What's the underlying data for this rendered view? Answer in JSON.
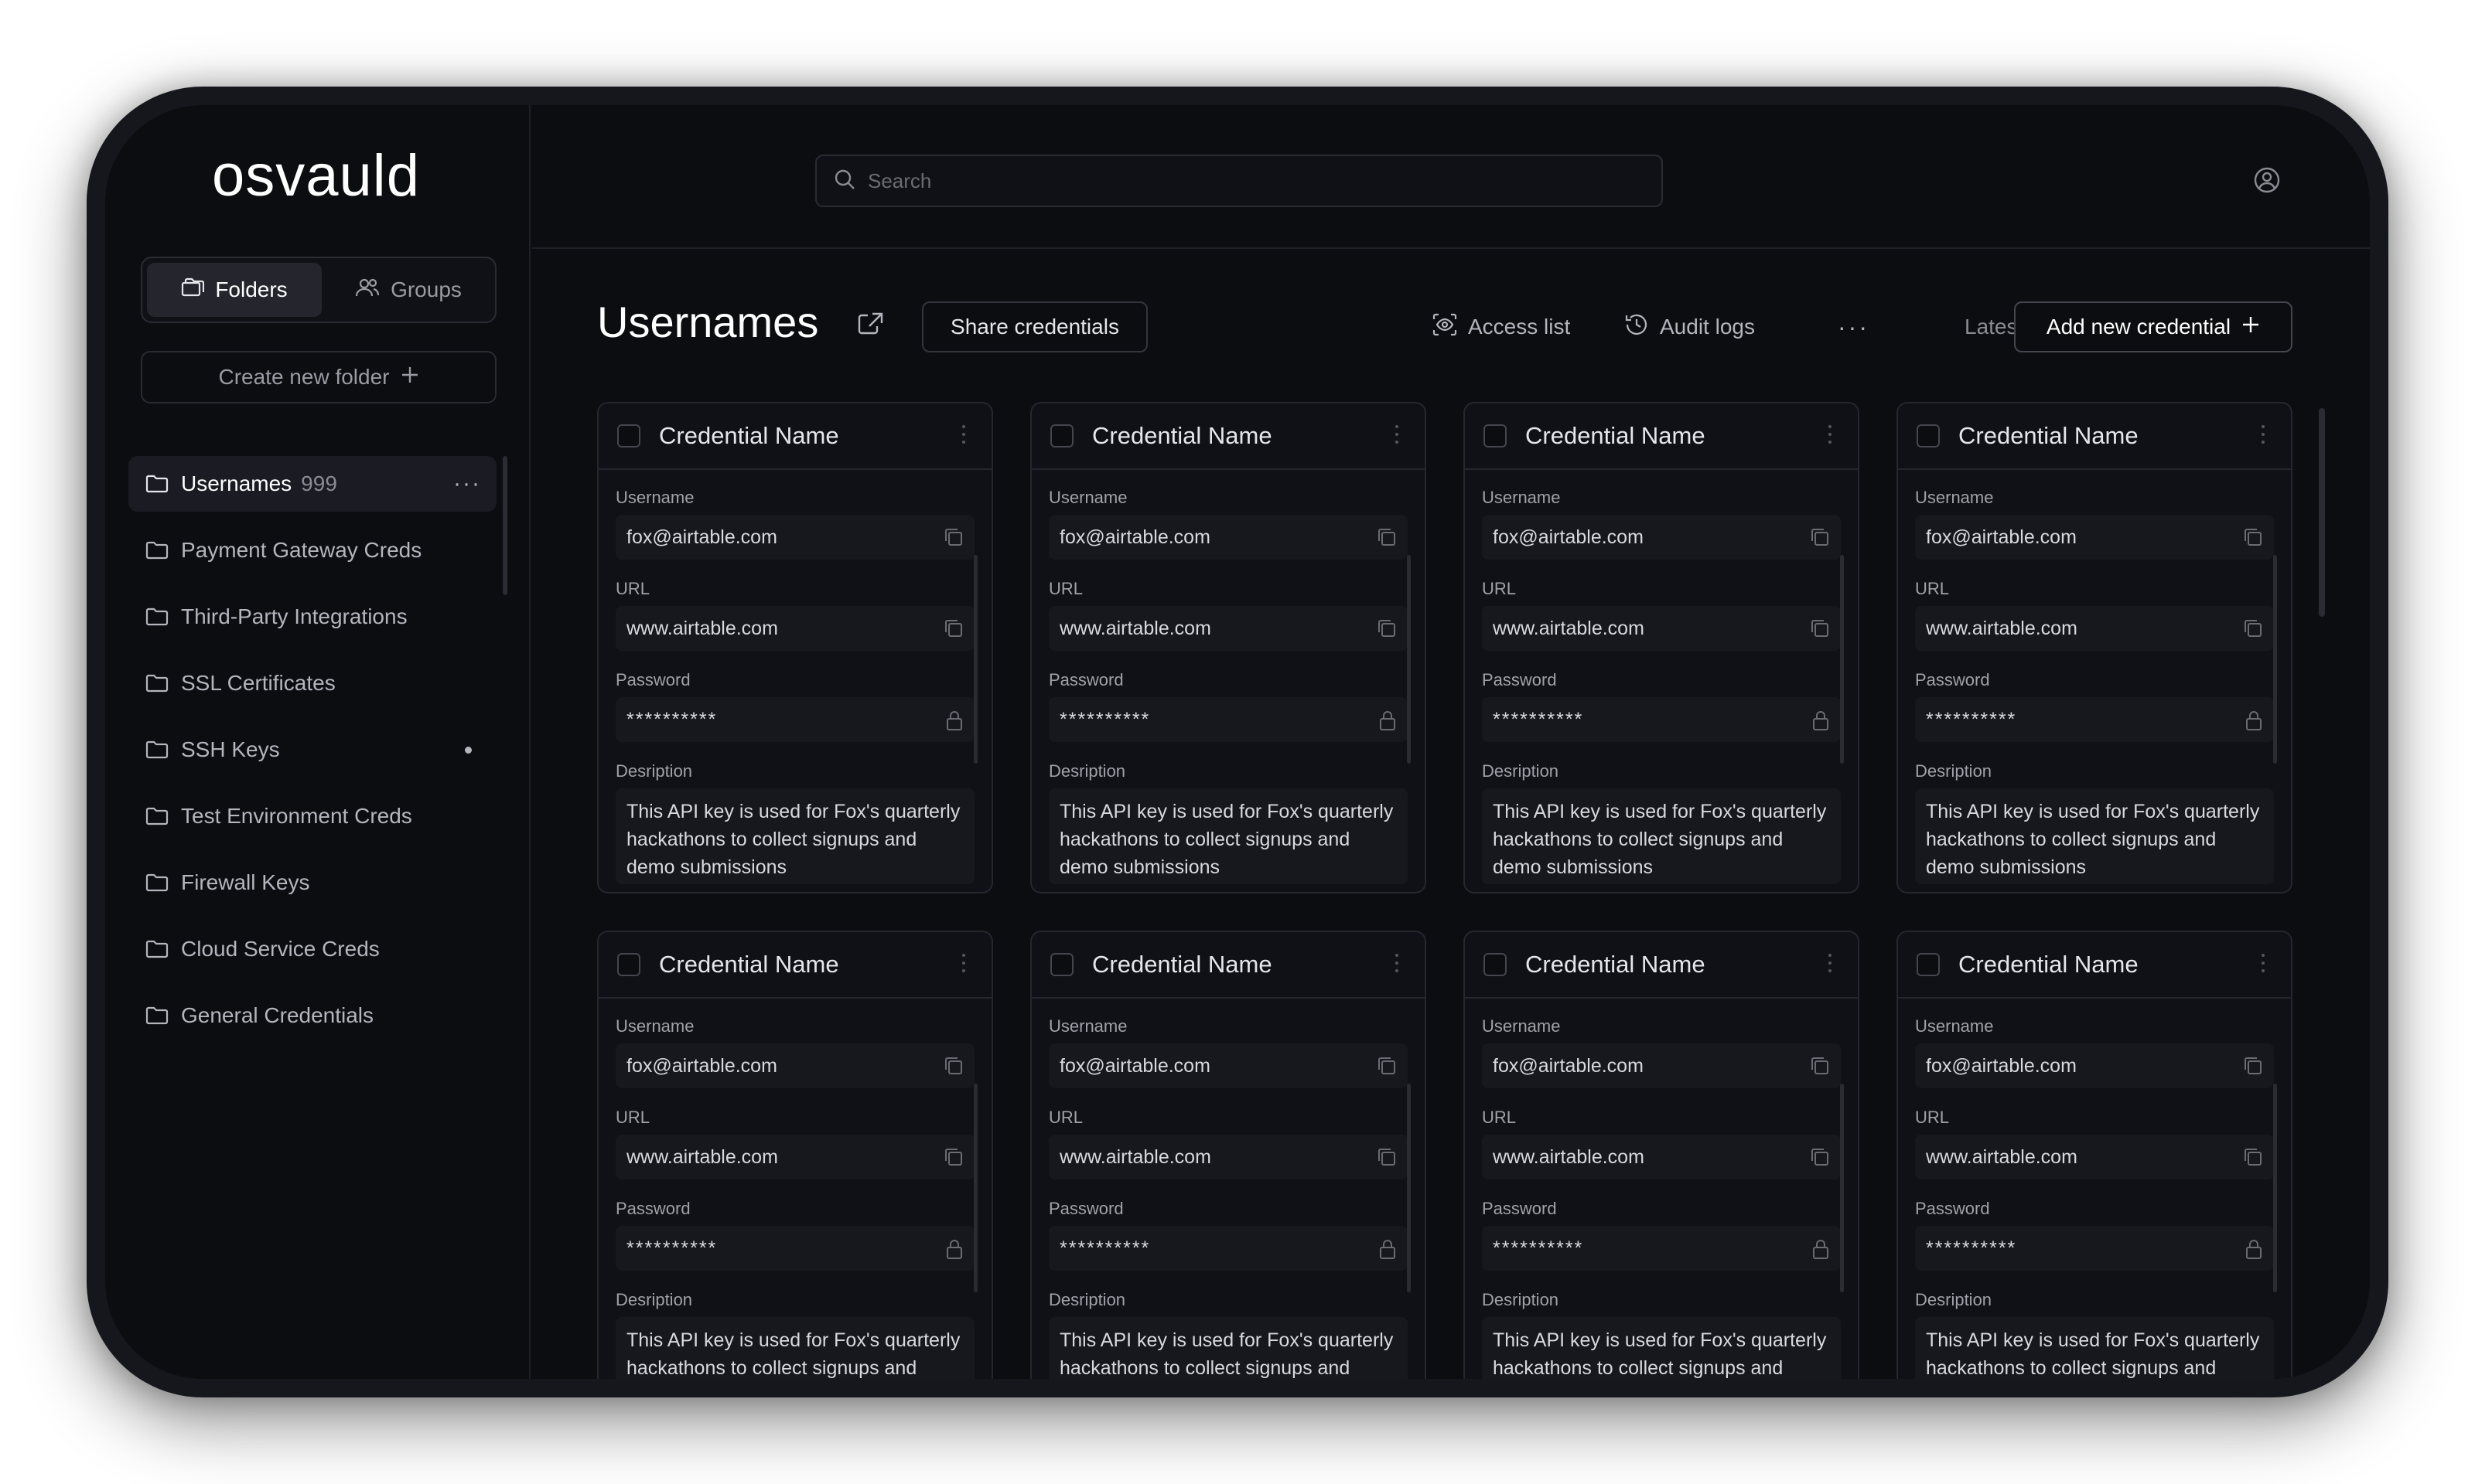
{
  "app": {
    "logo": "osvauld"
  },
  "sidebar": {
    "tabs": {
      "folders": "Folders",
      "groups": "Groups"
    },
    "create_folder": "Create new folder",
    "folders": [
      {
        "label": "Usernames",
        "count": "999",
        "active": true
      },
      {
        "label": "Payment Gateway Creds"
      },
      {
        "label": "Third-Party Integrations"
      },
      {
        "label": "SSL Certificates"
      },
      {
        "label": "SSH Keys",
        "dot": true
      },
      {
        "label": "Test Environment Creds"
      },
      {
        "label": "Firewall Keys"
      },
      {
        "label": "Cloud Service Creds"
      },
      {
        "label": "General Credentials"
      }
    ]
  },
  "search": {
    "placeholder": "Search"
  },
  "header": {
    "title": "Usernames",
    "share_label": "Share credentials",
    "access_list": "Access list",
    "audit_logs": "Audit logs",
    "more": "···",
    "sort": "Latest",
    "add_label": "Add new credential"
  },
  "card_labels": {
    "username": "Username",
    "url": "URL",
    "password": "Password",
    "description": "Desription"
  },
  "cards": [
    {
      "name": "Credential Name",
      "username": "fox@airtable.com",
      "url": "www.airtable.com",
      "password": "**********",
      "description": "This API key is used for Fox's quarterly hackathons to collect signups and demo submissions"
    },
    {
      "name": "Credential Name",
      "username": "fox@airtable.com",
      "url": "www.airtable.com",
      "password": "**********",
      "description": "This API key is used for Fox's quarterly hackathons to collect signups and demo submissions"
    },
    {
      "name": "Credential Name",
      "username": "fox@airtable.com",
      "url": "www.airtable.com",
      "password": "**********",
      "description": "This API key is used for Fox's quarterly hackathons to collect signups and demo submissions"
    },
    {
      "name": "Credential Name",
      "username": "fox@airtable.com",
      "url": "www.airtable.com",
      "password": "**********",
      "description": "This API key is used for Fox's quarterly hackathons to collect signups and demo submissions"
    },
    {
      "name": "Credential Name",
      "username": "fox@airtable.com",
      "url": "www.airtable.com",
      "password": "**********",
      "description": "This API key is used for Fox's quarterly hackathons to collect signups and demo submissions"
    },
    {
      "name": "Credential Name",
      "username": "fox@airtable.com",
      "url": "www.airtable.com",
      "password": "**********",
      "description": "This API key is used for Fox's quarterly hackathons to collect signups and demo submissions"
    },
    {
      "name": "Credential Name",
      "username": "fox@airtable.com",
      "url": "www.airtable.com",
      "password": "**********",
      "description": "This API key is used for Fox's quarterly hackathons to collect signups and demo submissions"
    },
    {
      "name": "Credential Name",
      "username": "fox@airtable.com",
      "url": "www.airtable.com",
      "password": "**********",
      "description": "This API key is used for Fox's quarterly hackathons to collect signups and demo submissions"
    }
  ],
  "icons": {
    "folder": "folder-icon",
    "groups": "users-icon",
    "plus": "plus-icon",
    "search": "search-icon",
    "avatar": "user-circle-icon",
    "share": "share-icon",
    "access": "eye-scan-icon",
    "audit": "history-icon",
    "copy": "copy-icon",
    "lock": "lock-icon",
    "chevron": "chevron-down-icon"
  }
}
